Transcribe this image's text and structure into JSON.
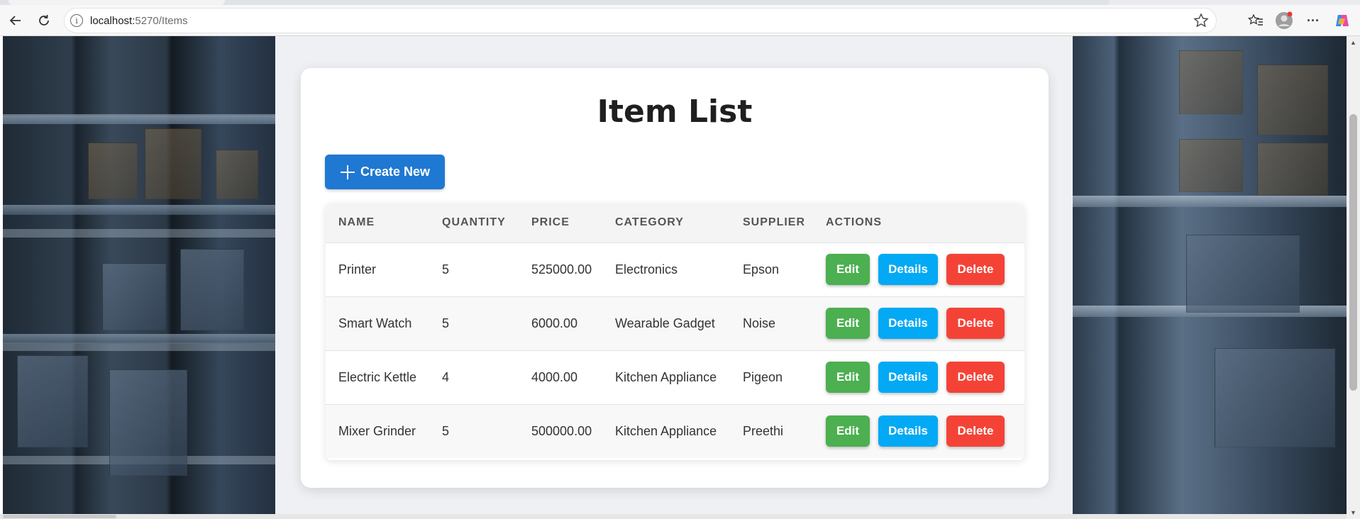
{
  "browser": {
    "url_host": "localhost:",
    "url_port_path": "5270/Items",
    "back_icon": "arrow-left-icon",
    "reload_icon": "reload-icon",
    "info_icon": "info-icon",
    "info_glyph": "i",
    "favorite_icon": "star-icon",
    "favorites_icon": "favorites-list-icon",
    "profile_icon": "avatar-icon",
    "more_icon": "more-icon",
    "more_glyph": "···",
    "copilot_icon": "copilot-icon"
  },
  "page": {
    "title": "Item List",
    "create_button_label": "Create New",
    "accent_color": "#1f78d1"
  },
  "table": {
    "headers": [
      "NAME",
      "QUANTITY",
      "PRICE",
      "CATEGORY",
      "SUPPLIER",
      "ACTIONS"
    ],
    "rows": [
      {
        "name": "Printer",
        "quantity": "5",
        "price": "525000.00",
        "category": "Electronics",
        "supplier": "Epson"
      },
      {
        "name": "Smart Watch",
        "quantity": "5",
        "price": "6000.00",
        "category": "Wearable Gadget",
        "supplier": "Noise"
      },
      {
        "name": "Electric Kettle",
        "quantity": "4",
        "price": "4000.00",
        "category": "Kitchen Appliance",
        "supplier": "Pigeon"
      },
      {
        "name": "Mixer Grinder",
        "quantity": "5",
        "price": "500000.00",
        "category": "Kitchen Appliance",
        "supplier": "Preethi"
      }
    ],
    "actions": {
      "edit_label": "Edit",
      "details_label": "Details",
      "delete_label": "Delete",
      "edit_color": "#4caf50",
      "details_color": "#03a9f4",
      "delete_color": "#f44336"
    }
  }
}
